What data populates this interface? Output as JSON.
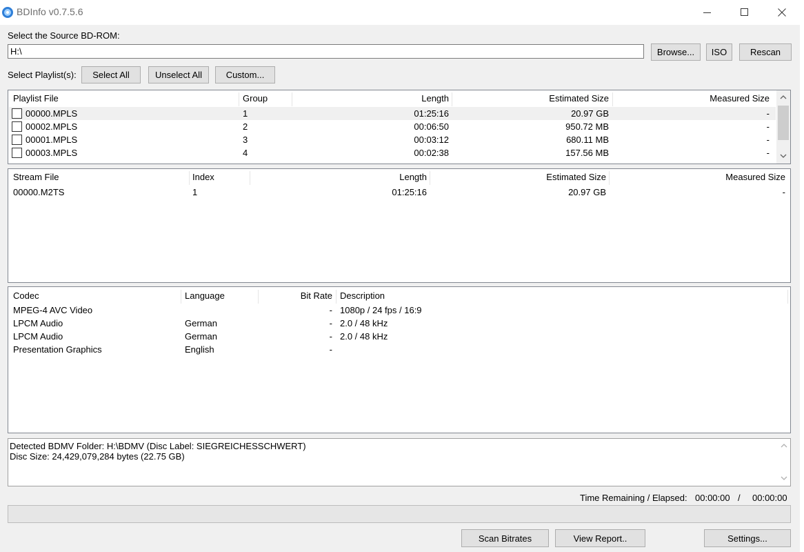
{
  "window": {
    "title": "BDInfo v0.7.5.6"
  },
  "source": {
    "label": "Select the Source BD-ROM:",
    "path": "H:\\",
    "browse_label": "Browse...",
    "iso_label": "ISO",
    "rescan_label": "Rescan"
  },
  "playlist_controls": {
    "label": "Select Playlist(s):",
    "select_all_label": "Select All",
    "unselect_all_label": "Unselect All",
    "custom_label": "Custom..."
  },
  "playlists": {
    "columns": [
      "Playlist File",
      "Group",
      "Length",
      "Estimated Size",
      "Measured Size"
    ],
    "rows": [
      {
        "file": "00000.MPLS",
        "group": "1",
        "length": "01:25:16",
        "estimated": "20.97 GB",
        "measured": "-"
      },
      {
        "file": "00002.MPLS",
        "group": "2",
        "length": "00:06:50",
        "estimated": "950.72 MB",
        "measured": "-"
      },
      {
        "file": "00001.MPLS",
        "group": "3",
        "length": "00:03:12",
        "estimated": "680.11 MB",
        "measured": "-"
      },
      {
        "file": "00003.MPLS",
        "group": "4",
        "length": "00:02:38",
        "estimated": "157.56 MB",
        "measured": "-"
      }
    ]
  },
  "streams": {
    "columns": [
      "Stream File",
      "Index",
      "Length",
      "Estimated Size",
      "Measured Size"
    ],
    "rows": [
      {
        "file": "00000.M2TS",
        "index": "1",
        "length": "01:25:16",
        "estimated": "20.97 GB",
        "measured": "-"
      }
    ]
  },
  "codecs": {
    "columns": [
      "Codec",
      "Language",
      "Bit Rate",
      "Description"
    ],
    "rows": [
      {
        "codec": "MPEG-4 AVC Video",
        "language": "",
        "bitrate": "-",
        "description": "1080p / 24 fps / 16:9"
      },
      {
        "codec": "LPCM Audio",
        "language": "German",
        "bitrate": "-",
        "description": "2.0 / 48 kHz"
      },
      {
        "codec": "LPCM Audio",
        "language": "German",
        "bitrate": "-",
        "description": "2.0 / 48 kHz"
      },
      {
        "codec": "Presentation Graphics",
        "language": "English",
        "bitrate": "-",
        "description": ""
      }
    ]
  },
  "info": {
    "lines": [
      "Detected BDMV Folder: H:\\BDMV (Disc Label: SIEGREICHESSCHWERT)",
      "Disc Size: 24,429,079,284 bytes (22.75 GB)"
    ]
  },
  "status": {
    "time_label": "Time Remaining / Elapsed:",
    "remaining": "00:00:00",
    "separator": "/",
    "elapsed": "00:00:00",
    "progress": 0
  },
  "actions": {
    "scan_label": "Scan Bitrates",
    "report_label": "View Report..",
    "settings_label": "Settings..."
  },
  "icons": {
    "app": "bluray-disc-icon",
    "minimize": "minimize-icon",
    "maximize": "maximize-icon",
    "close": "close-icon",
    "scroll_up": "chevron-up-icon",
    "scroll_down": "chevron-down-icon"
  }
}
